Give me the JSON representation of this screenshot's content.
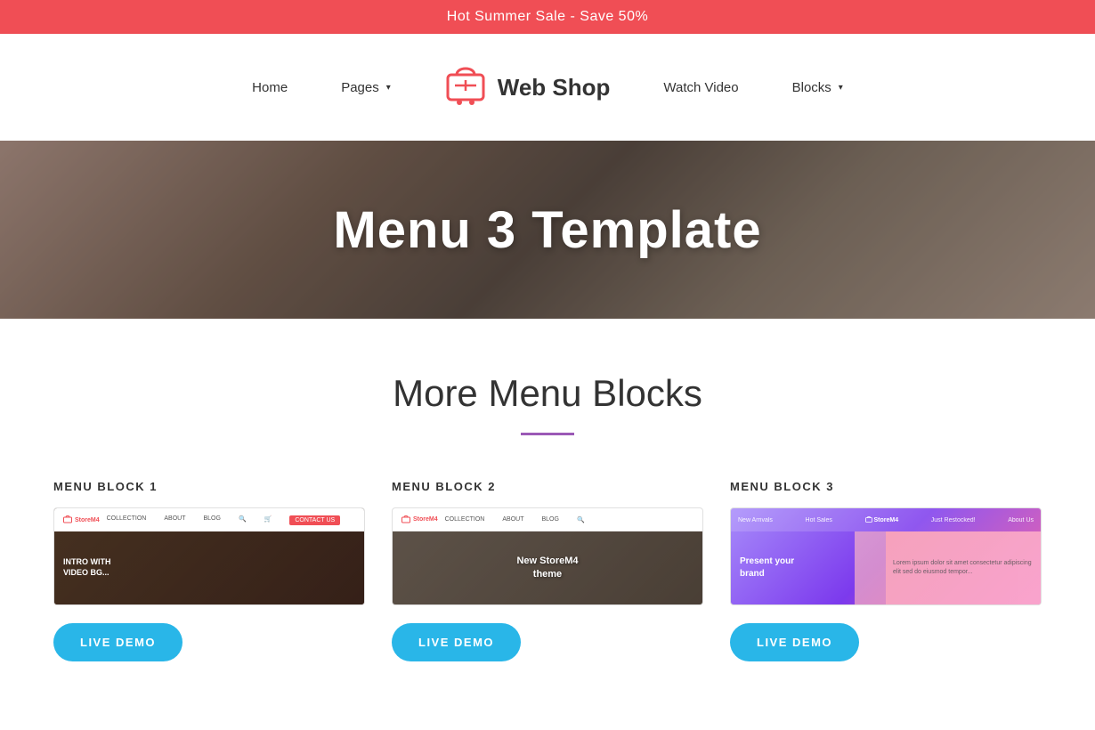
{
  "banner": {
    "text": "Hot Summer Sale - Save 50%"
  },
  "navbar": {
    "home_label": "Home",
    "pages_label": "Pages",
    "logo_text": "Web Shop",
    "watch_video_label": "Watch Video",
    "blocks_label": "Blocks"
  },
  "hero": {
    "title": "Menu 3 Template"
  },
  "section": {
    "title": "More Menu Blocks",
    "cards": [
      {
        "label": "MENU BLOCK 1",
        "preview_logo": "StoreM4",
        "preview_nav": "COLLECTION   ABOUT   BLOG   🔍  🛒  CONTACT US",
        "preview_text": "INTRO WITH\nVIDEO BG...",
        "button_label": "LIVE DEMO"
      },
      {
        "label": "MENU BLOCK 2",
        "preview_logo": "StoreM4",
        "preview_nav": "COLLECTION   ABOUT   BLOG   🔍",
        "preview_text": "New StoreM4\ntheme",
        "button_label": "LIVE DEMO"
      },
      {
        "label": "MENU BLOCK 3",
        "preview_tabs": "New Arrivals   Hot Sales   StoreM4   Just Restocked!   About Us",
        "preview_text": "Present your\nbrand",
        "button_label": "LIVE DEMO"
      }
    ]
  },
  "colors": {
    "accent_red": "#f04e55",
    "accent_blue": "#29b6e8",
    "accent_purple": "#9b59b6",
    "text_dark": "#333333",
    "text_white": "#ffffff"
  }
}
